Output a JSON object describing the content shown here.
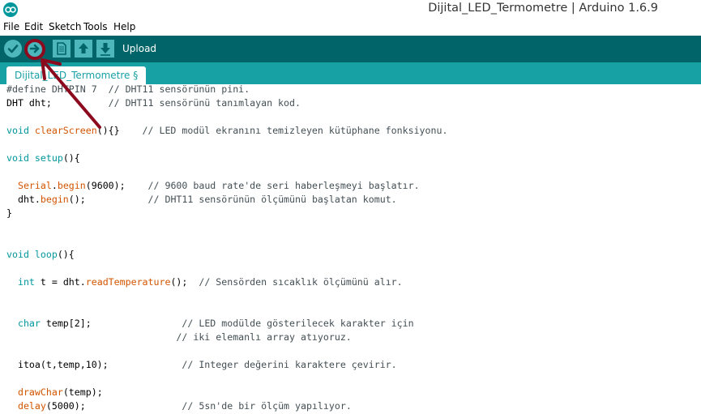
{
  "window": {
    "title": "Dijital_LED_Termometre | Arduino 1.6.9"
  },
  "menu": {
    "file": "File",
    "edit": "Edit",
    "sketch": "Sketch",
    "tools": "Tools",
    "help": "Help"
  },
  "toolbar": {
    "hover_label": "Upload",
    "buttons": [
      "verify-icon",
      "upload-icon",
      "new-icon",
      "open-icon",
      "save-icon"
    ]
  },
  "tabs": [
    {
      "label": "Dijital_LED_Termometre §"
    }
  ],
  "colors": {
    "toolbar_bg": "#006468",
    "tabstrip_bg": "#17a1a5",
    "button_bg": "#4db7bb",
    "keyword": "#00979c",
    "function": "#d35400",
    "comment": "#434f54",
    "annotation": "#8b0a1e"
  },
  "code": [
    [
      [
        "#define DHTPIN 7  // DHT11 sensörünün pini.",
        "cm"
      ]
    ],
    [
      [
        "DHT dht;          ",
        "tx"
      ],
      [
        "// DHT11 sensörünü tanımlayan kod.",
        "cm"
      ]
    ],
    [],
    [
      [
        "void",
        "kw"
      ],
      [
        " ",
        "tx"
      ],
      [
        "clearScreen",
        "fn"
      ],
      [
        "(){}    ",
        "tx"
      ],
      [
        "// LED modül ekranını temizleyen kütüphane fonksiyonu.",
        "cm"
      ]
    ],
    [],
    [
      [
        "void",
        "kw"
      ],
      [
        " ",
        "tx"
      ],
      [
        "setup",
        "kw"
      ],
      [
        "(){",
        "tx"
      ]
    ],
    [],
    [
      [
        "  ",
        "tx"
      ],
      [
        "Serial",
        "fn"
      ],
      [
        ".",
        "tx"
      ],
      [
        "begin",
        "fn"
      ],
      [
        "(9600);    ",
        "tx"
      ],
      [
        "// 9600 baud rate'de seri haberleşmeyi başlatır.",
        "cm"
      ]
    ],
    [
      [
        "  dht.",
        "tx"
      ],
      [
        "begin",
        "fn"
      ],
      [
        "();           ",
        "tx"
      ],
      [
        "// DHT11 sensörünün ölçümünü başlatan komut.",
        "cm"
      ]
    ],
    [
      [
        "}",
        "tx"
      ]
    ],
    [],
    [],
    [
      [
        "void",
        "kw"
      ],
      [
        " ",
        "tx"
      ],
      [
        "loop",
        "kw"
      ],
      [
        "(){",
        "tx"
      ]
    ],
    [],
    [
      [
        "  ",
        "tx"
      ],
      [
        "int",
        "kw"
      ],
      [
        " t = dht.",
        "tx"
      ],
      [
        "readTemperature",
        "fn"
      ],
      [
        "();  ",
        "tx"
      ],
      [
        "// Sensörden sıcaklık ölçümünü alır.",
        "cm"
      ]
    ],
    [],
    [],
    [
      [
        "  ",
        "tx"
      ],
      [
        "char",
        "kw"
      ],
      [
        " temp[2];                ",
        "tx"
      ],
      [
        "// LED modülde gösterilecek karakter için",
        "cm"
      ]
    ],
    [
      [
        "                              ",
        "tx"
      ],
      [
        "// iki elemanlı array atıyoruz.",
        "cm"
      ]
    ],
    [],
    [
      [
        "  itoa(t,temp,10);             ",
        "tx"
      ],
      [
        "// Integer değerini karaktere çevirir.",
        "cm"
      ]
    ],
    [],
    [
      [
        "  ",
        "tx"
      ],
      [
        "drawChar",
        "fn"
      ],
      [
        "(temp);",
        "tx"
      ]
    ],
    [
      [
        "  ",
        "tx"
      ],
      [
        "delay",
        "fn"
      ],
      [
        "(5000);                 ",
        "tx"
      ],
      [
        "// 5sn'de bir ölçüm yapılıyor.",
        "cm"
      ]
    ]
  ]
}
